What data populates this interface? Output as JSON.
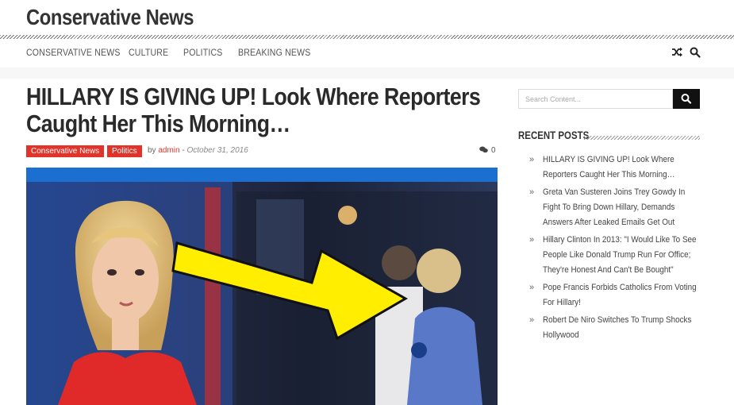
{
  "site": {
    "title": "Conservative News"
  },
  "nav": {
    "items": [
      {
        "label": "CONSERVATIVE NEWS"
      },
      {
        "label": "CULTURE"
      },
      {
        "label": "POLITICS"
      },
      {
        "label": "BREAKING NEWS"
      }
    ],
    "icons": [
      "shuffle-icon",
      "search-icon"
    ]
  },
  "post": {
    "title": "HILLARY IS GIVING UP! Look Where Reporters Caught Her This Morning…",
    "categories": [
      "Conservative News",
      "Politics"
    ],
    "by": "by",
    "author": "admin",
    "separator": "-",
    "date": "October 31, 2016",
    "comments": "0"
  },
  "sidebar": {
    "search": {
      "placeholder": "Search Content..."
    },
    "recent_title": "RECENT POSTS",
    "recent": [
      "HILLARY IS GIVING UP! Look Where Reporters Caught Her This Morning…",
      "Greta Van Susteren Joins Trey Gowdy In Fight To Bring Down Hillary, Demands Answers After Leaked Emails Get Out",
      "Hillary Clinton In 2013: \"I Would Like To See People Like Donald Trump Run For Office; They're Honest And Can't Be Bought\"",
      "Pope Francis Forbids Catholics From Voting For Hillary!",
      "Robert De Niro Switches To Trump Shocks Hollywood"
    ]
  },
  "colors": {
    "accent": "#e2332a",
    "button": "#111111",
    "text": "#2a2a2a"
  }
}
